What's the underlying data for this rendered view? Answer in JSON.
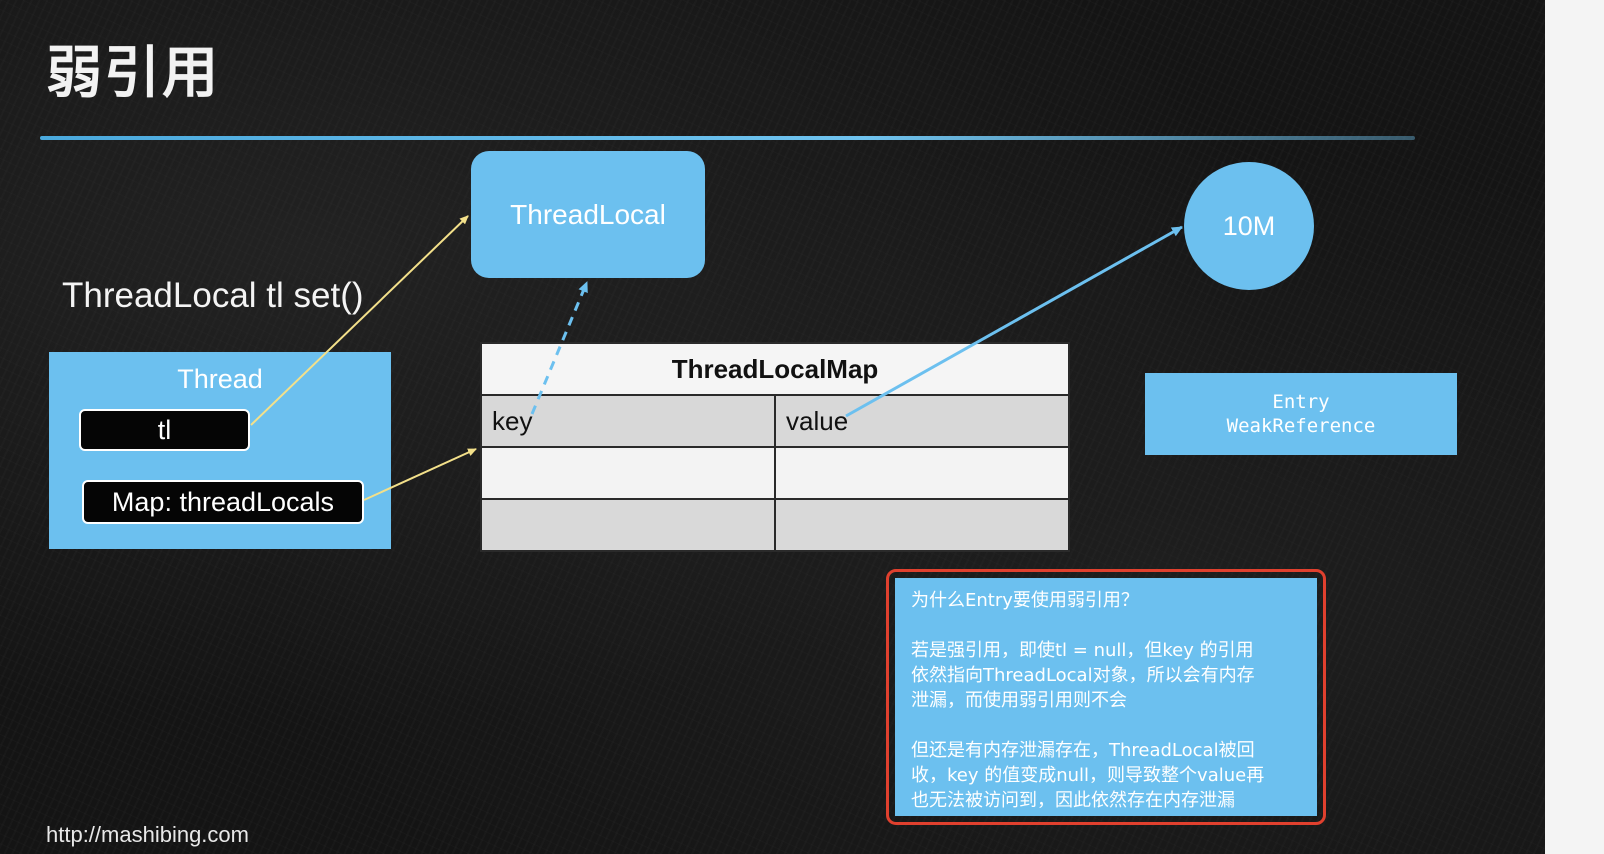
{
  "title": "弱引用",
  "subtitle": "ThreadLocal tl set()",
  "threadlocal_box": {
    "label": "ThreadLocal"
  },
  "value_circle": {
    "label": "10M"
  },
  "thread_box": {
    "label": "Thread",
    "field_tl": "tl",
    "field_map": "Map: threadLocals"
  },
  "map_table": {
    "title": "ThreadLocalMap",
    "key_header": "key",
    "value_header": "value"
  },
  "entry_box": {
    "line1": "Entry",
    "line2": "WeakReference"
  },
  "note": {
    "question": "为什么Entry要使用弱引用？",
    "para1_line1": "若是强引用，即使tl = null，但key 的引用",
    "para1_line2": "依然指向ThreadLocal对象，所以会有内存",
    "para1_line3": "泄漏，而使用弱引用则不会",
    "para2_line1": "但还是有内存泄漏存在，ThreadLocal被回",
    "para2_line2": "收，key 的值变成null，则导致整个value再",
    "para2_line3": "也无法被访问到，因此依然存在内存泄漏"
  },
  "footer": {
    "url": "http://mashibing.com"
  },
  "colors": {
    "box_blue": "#6cc0ef",
    "arrow_yellow": "#f3e08a",
    "arrow_blue": "#6cc0ef",
    "highlight_red": "#e0402e"
  }
}
